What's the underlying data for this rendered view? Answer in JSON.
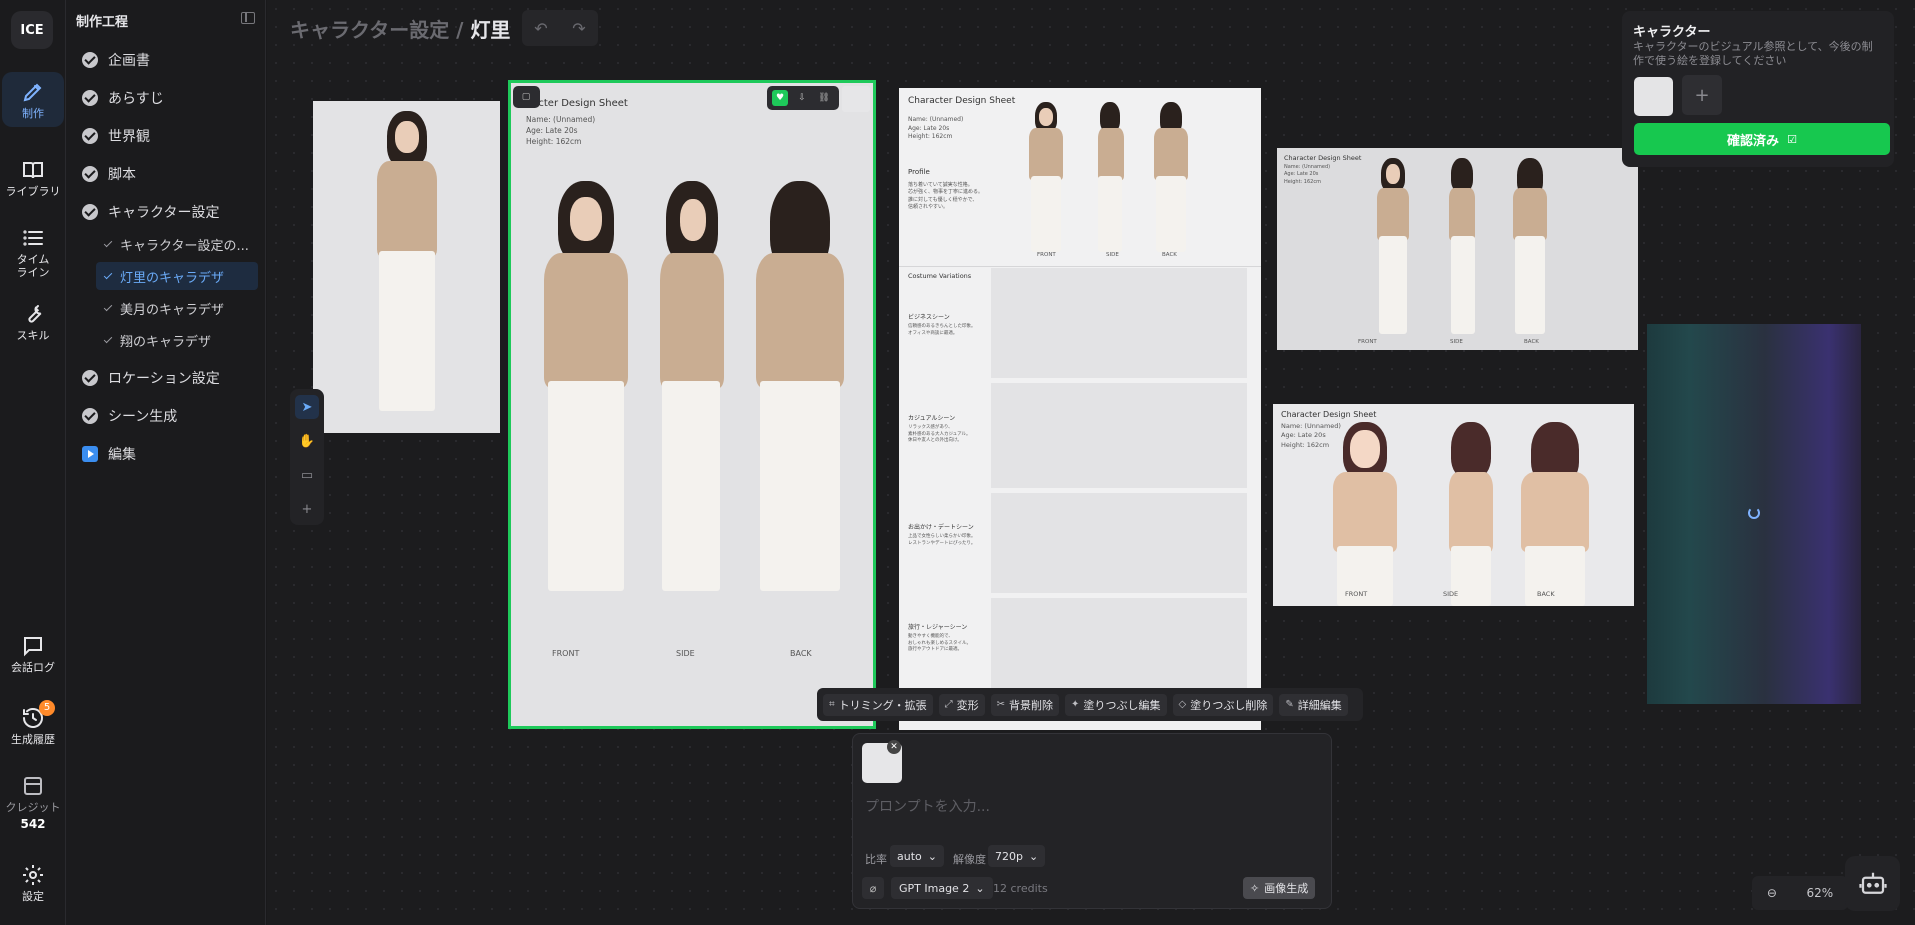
{
  "rail": {
    "logo": "ICE",
    "items": [
      {
        "label": "制作",
        "icon": "pen-icon"
      },
      {
        "label": "ライブラリ",
        "icon": "book-icon"
      },
      {
        "label": "タイム\nライン",
        "icon": "list-icon"
      },
      {
        "label": "スキル",
        "icon": "wrench-icon"
      }
    ],
    "bottom": [
      {
        "label": "会話ログ",
        "icon": "chat-icon"
      },
      {
        "label": "生成履歴",
        "icon": "history-icon",
        "badge": "5"
      },
      {
        "label": "クレジット",
        "icon": "credit-icon",
        "value": "542"
      },
      {
        "label": "設定",
        "icon": "gear-icon"
      }
    ]
  },
  "panel": {
    "title": "制作工程",
    "steps": [
      {
        "label": "企画書",
        "status": "done"
      },
      {
        "label": "あらすじ",
        "status": "done"
      },
      {
        "label": "世界観",
        "status": "done"
      },
      {
        "label": "脚本",
        "status": "done"
      },
      {
        "label": "キャラクター設定",
        "status": "done"
      },
      {
        "label": "ロケーション設定",
        "status": "done"
      },
      {
        "label": "シーン生成",
        "status": "done"
      },
      {
        "label": "編集",
        "status": "current"
      }
    ],
    "subitems": [
      {
        "label": "キャラクター設定の..."
      },
      {
        "label": "灯里のキャラデザ"
      },
      {
        "label": "美月のキャラデザ"
      },
      {
        "label": "翔のキャラデザ"
      }
    ]
  },
  "header": {
    "crumb_parent": "キャラクター設定",
    "sep": " / ",
    "crumb_current": "灯里"
  },
  "sheet": {
    "title": "Character Design Sheet",
    "title_cropped": "aracter Design Sheet",
    "name": "Name: (Unnamed)",
    "age": "Age: Late 20s",
    "height": "Height: 162cm",
    "front": "FRONT",
    "side": "SIDE",
    "back": "BACK",
    "profile": "Profile",
    "profile_text": "落ち着いていて誠実な性格。\n芯が強く、物事を丁寧に進める。\n誰に対しても優しく穏やかで、\n信頼されやすい。",
    "costume": "Costume Variations",
    "scenes": [
      {
        "title": "ビジネスシーン",
        "text": "信頼感のあるきちんとした印象。\nオフィスや商談に最適。"
      },
      {
        "title": "カジュアルシーン",
        "text": "リラックス感があり、\n素朴感のある大人カジュアル。\n休日や友人との外出向け。"
      },
      {
        "title": "お出かけ・デートシーン",
        "text": "上品で女性らしい柔らかい印象。\nレストランやデートにぴったり。"
      },
      {
        "title": "旅行・レジャーシーン",
        "text": "動きやすく機能的で、\nおしゃれも楽しめるスタイル。\n旅行やアウトドアに最適。"
      }
    ],
    "mini_name": "Name: (Unnamed)",
    "mini_age": "Age: Late 20s",
    "mini_height": "Height: 162cm"
  },
  "edit_toolbar": [
    {
      "label": "トリミング・拡張",
      "icon": "crop-icon"
    },
    {
      "label": "変形",
      "icon": "transform-icon"
    },
    {
      "label": "背景削除",
      "icon": "scissors-icon"
    },
    {
      "label": "塗りつぶし編集",
      "icon": "wand-icon"
    },
    {
      "label": "塗りつぶし削除",
      "icon": "eraser-icon"
    },
    {
      "label": "詳細編集",
      "icon": "pencil-icon"
    }
  ],
  "prompt": {
    "placeholder": "プロンプトを入力...",
    "ratio_label": "比率",
    "ratio_value": "auto",
    "resolution_label": "解像度",
    "resolution_value": "720p",
    "model": "GPT Image 2",
    "credits": "12 credits",
    "generate": "画像生成"
  },
  "character_card": {
    "title": "キャラクター",
    "description": "キャラクターのビジュアル参照として、今後の制作で使う絵を登録してください",
    "confirm": "確認済み"
  },
  "zoom": {
    "value": "62%"
  },
  "colors": {
    "accent_green": "#1ec95a",
    "accent_blue": "#6aaaf7",
    "badge": "#ff8a2a"
  }
}
